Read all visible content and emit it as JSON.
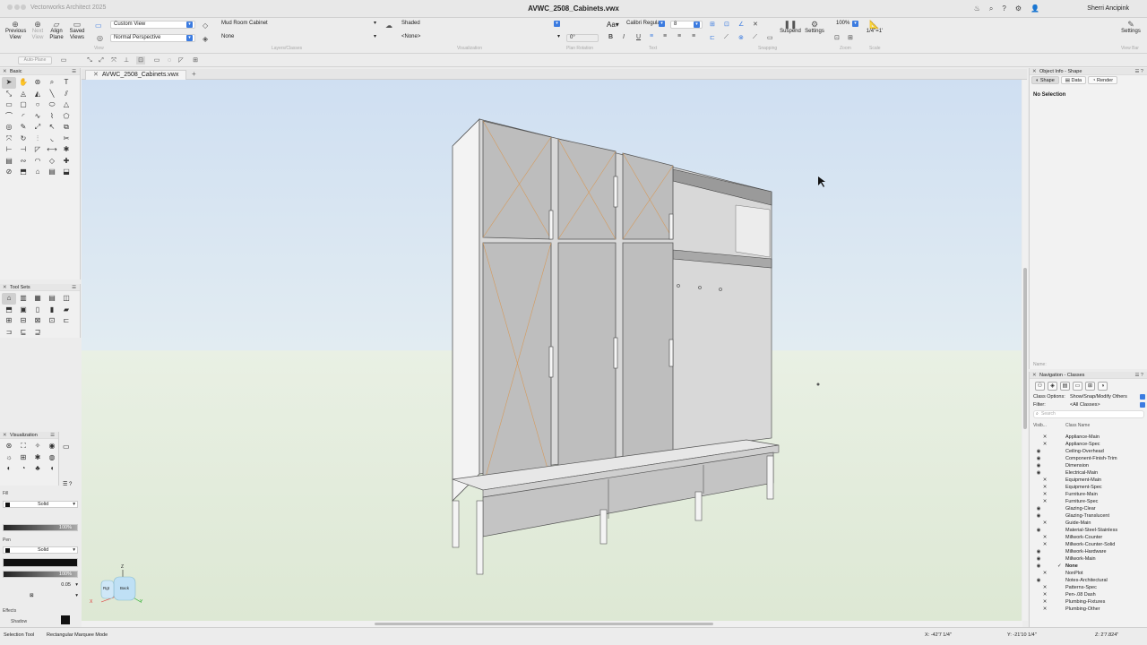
{
  "window": {
    "app_name": "Vectorworks Architect 2025",
    "document_title": "AVWC_2508_Cabinets.vwx",
    "user": "Sherri Ancipink"
  },
  "toolbar": {
    "previous_view": "Previous View",
    "next_view": "Next View",
    "align_plane": "Align Plane",
    "saved_views": "Saved Views",
    "view_label": "View",
    "view_select": "Custom View",
    "projection_select": "Normal Perspective",
    "layer_select": "Mud Room Cabinet",
    "class_select": "None",
    "layers_classes_label": "Layers/Classes",
    "render_mode": "Shaded",
    "render_sub": "<None>",
    "visualization_label": "Visualization",
    "rotation_value": "0°",
    "plan_rotation_label": "Plan Rotation",
    "font_name": "Calibri Regular",
    "font_size": "8",
    "text_label": "Text",
    "snapping_label": "Snapping",
    "suspend_label": "Suspend",
    "settings_label": "Settings",
    "zoom_value": "100%",
    "zoom_label": "Zoom",
    "scale_value": "1/4\"=1'",
    "scale_label": "Scale",
    "view_bar_label": "View Bar",
    "right_settings": "Settings"
  },
  "secondary": {
    "active_plane": "Auto-Plane"
  },
  "palettes": {
    "basic_title": "Basic",
    "toolsets_title": "Tool Sets",
    "visualization_title": "Visualization"
  },
  "attributes": {
    "fill_label": "Fill",
    "fill_style": "Solid",
    "fill_opacity": "100%",
    "pen_label": "Pen",
    "pen_style": "Solid",
    "pen_opacity": "100%",
    "line_weight": "0.05",
    "effects_label": "Effects",
    "shadow_label": "Shadow"
  },
  "tabs": {
    "doc_tab": "AVWC_2508_Cabinets.vwx"
  },
  "object_info": {
    "title": "Object Info - Shape",
    "tab_shape": "Shape",
    "tab_data": "Data",
    "tab_render": "Render",
    "selection": "No Selection",
    "name_label": "Name:"
  },
  "navigation": {
    "title": "Navigation - Classes",
    "class_options_label": "Class Options:",
    "class_options_value": "Show/Snap/Modify Others",
    "filter_label": "Filter:",
    "filter_value": "<All Classes>",
    "search_placeholder": "Search",
    "col_visibility": "Visib...",
    "col_class_name": "Class Name",
    "classes": [
      {
        "name": "Appliance-Main",
        "vis": "x"
      },
      {
        "name": "Appliance-Spec",
        "vis": "x"
      },
      {
        "name": "Ceiling-Overhead",
        "vis": "eye"
      },
      {
        "name": "Component-Finish-Trim",
        "vis": "eye"
      },
      {
        "name": "Dimension",
        "vis": "eye"
      },
      {
        "name": "Electrical-Main",
        "vis": "eye"
      },
      {
        "name": "Equipment-Main",
        "vis": "x"
      },
      {
        "name": "Equipment-Spec",
        "vis": "x"
      },
      {
        "name": "Furniture-Main",
        "vis": "x"
      },
      {
        "name": "Furniture-Spec",
        "vis": "x"
      },
      {
        "name": "Glazing-Clear",
        "vis": "eye"
      },
      {
        "name": "Glazing-Translucent",
        "vis": "eye"
      },
      {
        "name": "Guide-Main",
        "vis": "x"
      },
      {
        "name": "Material-Steel-Stainless",
        "vis": "eye"
      },
      {
        "name": "Millwork-Counter",
        "vis": "x"
      },
      {
        "name": "Millwork-Counter-Solid",
        "vis": "x"
      },
      {
        "name": "Millwork-Hardware",
        "vis": "eye"
      },
      {
        "name": "Millwork-Main",
        "vis": "eye"
      },
      {
        "name": "None",
        "vis": "eye",
        "active": true
      },
      {
        "name": "NonPlot",
        "vis": "x"
      },
      {
        "name": "Notes-Architectural",
        "vis": "eye"
      },
      {
        "name": "Patterns-Spec",
        "vis": "x"
      },
      {
        "name": "Pen-.08 Dash",
        "vis": "x"
      },
      {
        "name": "Plumbing-Fixtures",
        "vis": "x"
      },
      {
        "name": "Plumbing-Other",
        "vis": "x"
      }
    ]
  },
  "status": {
    "tool": "Selection Tool",
    "mode": "Rectangular Marquee Mode",
    "x_coord": "X: -42'7 1/4\"",
    "y_coord": "Y: -21'10 1/4\"",
    "z_coord": "Z: 2'7.824\""
  },
  "view_cube": {
    "top_label": "Z",
    "front_label": "Rgt",
    "back_label": "Back",
    "axis_x": "X",
    "axis_y": "Y"
  }
}
